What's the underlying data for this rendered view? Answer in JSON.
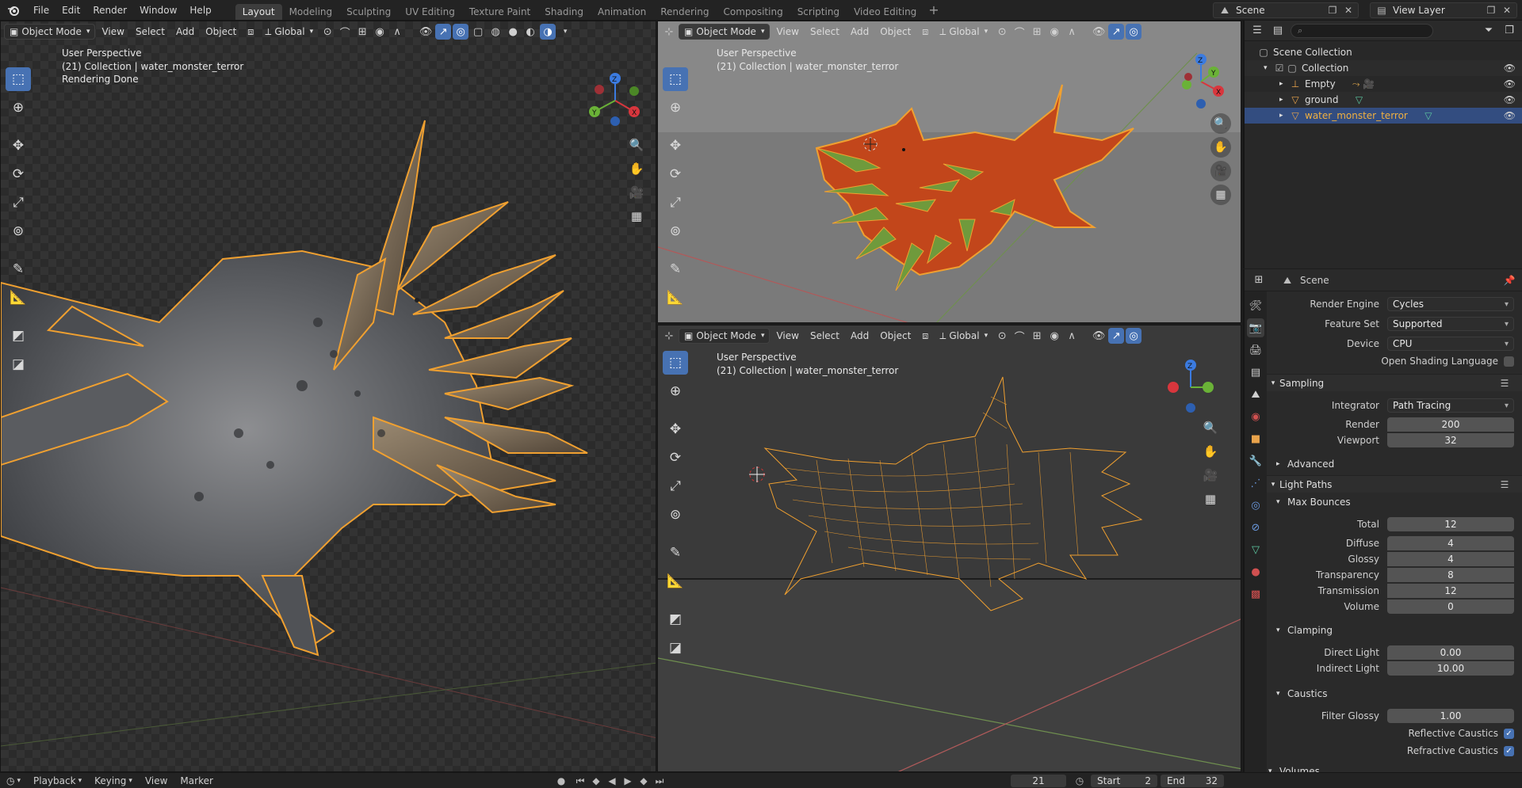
{
  "topbar": {
    "menu": [
      "File",
      "Edit",
      "Render",
      "Window",
      "Help"
    ],
    "workspaces": [
      "Layout",
      "Modeling",
      "Sculpting",
      "UV Editing",
      "Texture Paint",
      "Shading",
      "Animation",
      "Rendering",
      "Compositing",
      "Scripting",
      "Video Editing"
    ],
    "active_workspace": "Layout",
    "scene_name": "Scene",
    "view_layer": "View Layer"
  },
  "viewport_header": {
    "mode": "Object Mode",
    "menus": [
      "View",
      "Select",
      "Add",
      "Object"
    ],
    "transform_orientation": "Global"
  },
  "viewports": {
    "left": {
      "perspective": "User Perspective",
      "collection": "(21) Collection | water_monster_terror",
      "status": "Rendering Done"
    },
    "top_right": {
      "perspective": "User Perspective",
      "collection": "(21) Collection | water_monster_terror"
    },
    "bottom_right": {
      "perspective": "User Perspective",
      "collection": "(21) Collection | water_monster_terror"
    }
  },
  "gizmo_labels": {
    "x": "X",
    "y": "Y",
    "z": "Z"
  },
  "outliner": {
    "search_placeholder": "",
    "root": "Scene Collection",
    "collection": "Collection",
    "items": [
      {
        "name": "Empty"
      },
      {
        "name": "ground"
      },
      {
        "name": "water_monster_terror",
        "selected": true
      }
    ]
  },
  "properties": {
    "context": "Scene",
    "render_engine_label": "Render Engine",
    "render_engine": "Cycles",
    "feature_set_label": "Feature Set",
    "feature_set": "Supported",
    "device_label": "Device",
    "device": "CPU",
    "osl_label": "Open Shading Language",
    "sampling": {
      "title": "Sampling",
      "integrator_label": "Integrator",
      "integrator": "Path Tracing",
      "render_label": "Render",
      "render": "200",
      "viewport_label": "Viewport",
      "viewport": "32",
      "advanced": "Advanced"
    },
    "light_paths": {
      "title": "Light Paths",
      "max_bounces": "Max Bounces",
      "total_label": "Total",
      "total": "12",
      "diffuse_label": "Diffuse",
      "diffuse": "4",
      "glossy_label": "Glossy",
      "glossy": "4",
      "transparency_label": "Transparency",
      "transparency": "8",
      "transmission_label": "Transmission",
      "transmission": "12",
      "volume_label": "Volume",
      "volume": "0",
      "clamping": "Clamping",
      "direct_light_label": "Direct Light",
      "direct_light": "0.00",
      "indirect_light_label": "Indirect Light",
      "indirect_light": "10.00",
      "caustics": "Caustics",
      "filter_glossy_label": "Filter Glossy",
      "filter_glossy": "1.00",
      "reflective_caustics_label": "Reflective Caustics",
      "refractive_caustics_label": "Refractive Caustics"
    },
    "volumes": "Volumes"
  },
  "timeline": {
    "playback": "Playback",
    "keying": "Keying",
    "view": "View",
    "marker": "Marker",
    "current_frame": "21",
    "start_label": "Start",
    "start": "2",
    "end_label": "End",
    "end": "32"
  },
  "colors": {
    "accent": "#4772b3",
    "selection_outline": "#f5a623",
    "monster_solid": "#c2461b",
    "spikes_solid": "#6f9a3c"
  }
}
